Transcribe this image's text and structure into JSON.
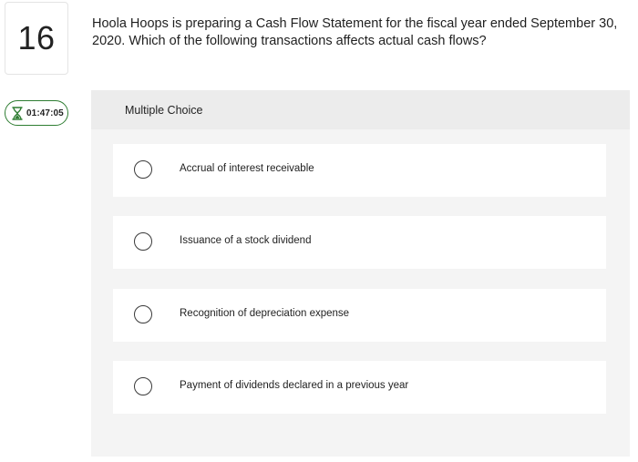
{
  "question": {
    "number": "16",
    "text": "Hoola Hoops is preparing a Cash Flow Statement for the fiscal year ended September 30, 2020. Which of the following transactions affects actual cash flows?"
  },
  "timer": {
    "icon": "hourglass-icon",
    "value": "01:47:05",
    "color": "#2e7d32"
  },
  "answer_panel": {
    "title": "Multiple Choice",
    "options": [
      {
        "label": "Accrual of interest receivable",
        "selected": false
      },
      {
        "label": "Issuance of a stock dividend",
        "selected": false
      },
      {
        "label": "Recognition of depreciation expense",
        "selected": false
      },
      {
        "label": "Payment of dividends declared in a previous year",
        "selected": false
      }
    ]
  }
}
